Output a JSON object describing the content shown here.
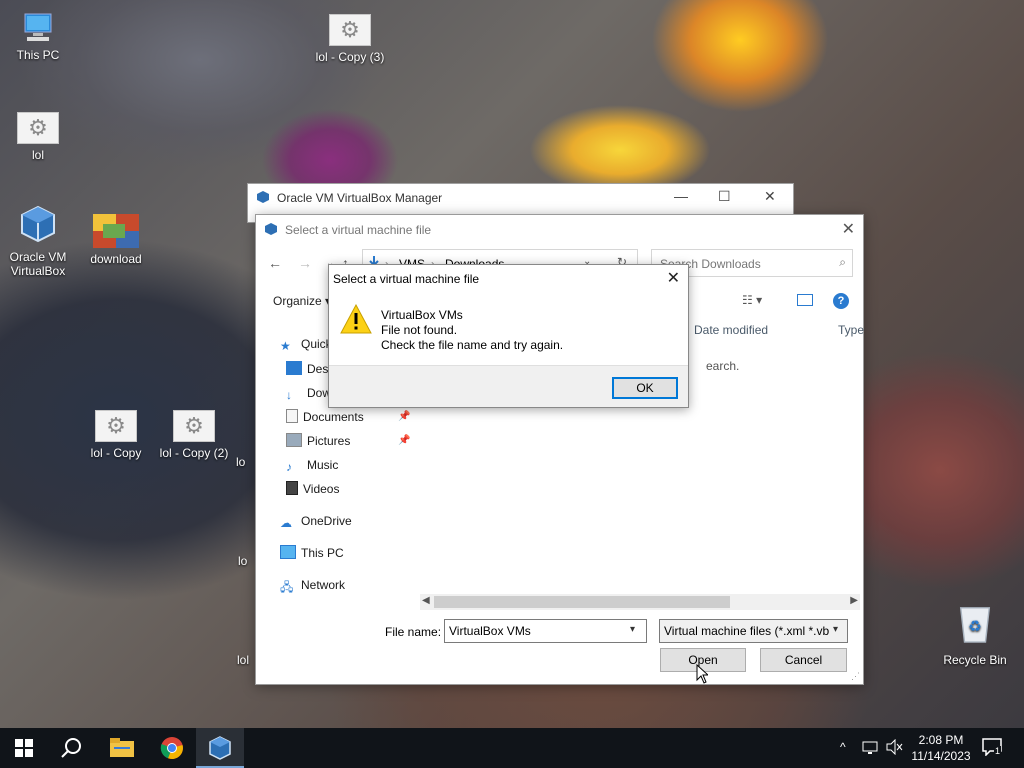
{
  "desktop": {
    "icons": [
      {
        "id": "this-pc",
        "label": "This PC"
      },
      {
        "id": "lol-copy-3",
        "label": "lol - Copy (3)"
      },
      {
        "id": "lol",
        "label": "lol"
      },
      {
        "id": "oracle-vm-virtualbox",
        "label": "Oracle VM VirtualBox"
      },
      {
        "id": "download",
        "label": "download"
      },
      {
        "id": "lol-copy",
        "label": "lol - Copy"
      },
      {
        "id": "lol-copy-2",
        "label": "lol - Copy (2)"
      },
      {
        "id": "recycle-bin",
        "label": "Recycle Bin"
      }
    ],
    "partial_labels": [
      "lo",
      "lo",
      "lol"
    ]
  },
  "vbox_manager": {
    "title": "Oracle VM VirtualBox Manager"
  },
  "file_dialog": {
    "title": "Select a virtual machine file",
    "address_parts": [
      "VMS",
      "Downloads"
    ],
    "search_placeholder": "Search Downloads",
    "organize_label": "Organize",
    "columns": [
      "Date modified",
      "Type"
    ],
    "empty_fragment": "earch.",
    "nav_items": [
      {
        "label": "Quick",
        "icon": "star-icon"
      },
      {
        "label": "Desk",
        "icon": "desktop-icon"
      },
      {
        "label": "Dow",
        "icon": "download-arrow-icon"
      },
      {
        "label": "Documents",
        "icon": "documents-icon"
      },
      {
        "label": "Pictures",
        "icon": "pictures-icon"
      },
      {
        "label": "Music",
        "icon": "music-icon"
      },
      {
        "label": "Videos",
        "icon": "videos-icon"
      },
      {
        "label": "OneDrive",
        "icon": "cloud-icon"
      },
      {
        "label": "This PC",
        "icon": "computer-icon"
      },
      {
        "label": "Network",
        "icon": "network-icon"
      }
    ],
    "file_name_label": "File name:",
    "file_name_value": "VirtualBox VMs",
    "file_type_value": "Virtual machine files (*.xml *.vb",
    "open_label": "Open",
    "cancel_label": "Cancel"
  },
  "message_box": {
    "title": "Select a virtual machine file",
    "lines": [
      "VirtualBox VMs",
      "File not found.",
      "Check the file name and try again."
    ],
    "ok_label": "OK"
  },
  "taskbar": {
    "time": "2:08 PM",
    "date": "11/14/2023",
    "notification_count": "1"
  },
  "colors": {
    "accent": "#0078d7",
    "taskbar": "#101419"
  }
}
